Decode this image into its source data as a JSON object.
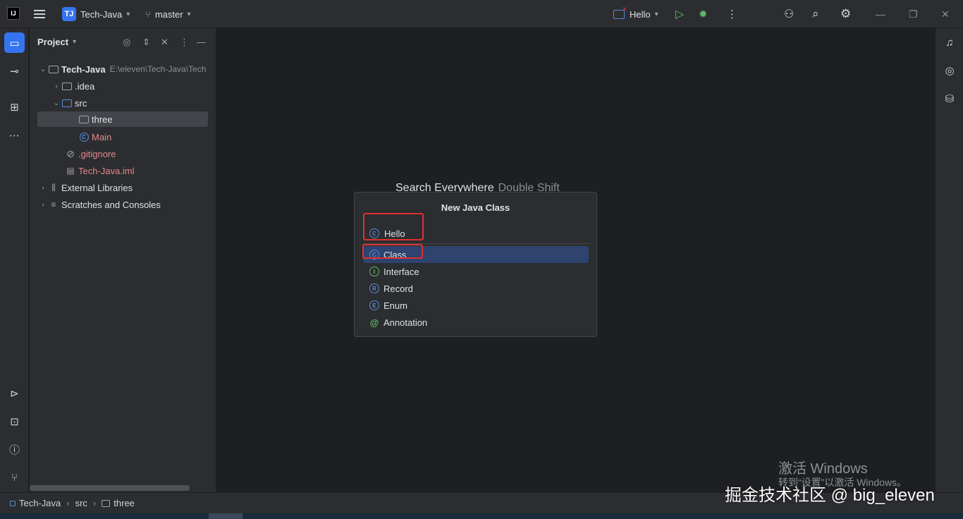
{
  "titlebar": {
    "logo": "IJ",
    "project_badge": "TJ",
    "project_name": "Tech-Java",
    "branch": "master",
    "run_config": "Hello"
  },
  "project_panel": {
    "title": "Project",
    "tree": [
      {
        "label": "Tech-Java",
        "path": "E:\\eleven\\Tech-Java\\Tech",
        "icon": "folder-icon"
      },
      {
        "label": ".idea",
        "icon": "folder-icon"
      },
      {
        "label": "src",
        "icon": "source-folder-icon"
      },
      {
        "label": "three",
        "icon": "package-icon"
      },
      {
        "label": "Main",
        "icon": "class-icon"
      },
      {
        "label": ".gitignore",
        "icon": "ignore-file-icon"
      },
      {
        "label": "Tech-Java.iml",
        "icon": "module-file-icon"
      },
      {
        "label": "External Libraries",
        "icon": "library-icon"
      },
      {
        "label": "Scratches and Consoles",
        "icon": "scratches-icon"
      }
    ]
  },
  "editor": {
    "hint_action": "Search Everywhere",
    "hint_shortcut": "Double Shift"
  },
  "popup": {
    "title": "New Java Class",
    "name_value": "Hello",
    "options": [
      "Class",
      "Interface",
      "Record",
      "Enum",
      "Annotation"
    ],
    "option_glyphs": [
      "C",
      "I",
      "R",
      "E",
      "@"
    ],
    "selected": "Class"
  },
  "statusbar": {
    "crumbs": [
      "Tech-Java",
      "src",
      "three"
    ]
  },
  "overlay": {
    "activation_title": "激活 Windows",
    "activation_sub": "转到“设置”以激活 Windows。",
    "watermark": "掘金技术社区 @ big_eleven"
  },
  "colors": {
    "accent": "#3574f0",
    "selection": "#2e436e",
    "highlight_box": "#e03030",
    "vcs_modified_text": "#e5888a"
  }
}
